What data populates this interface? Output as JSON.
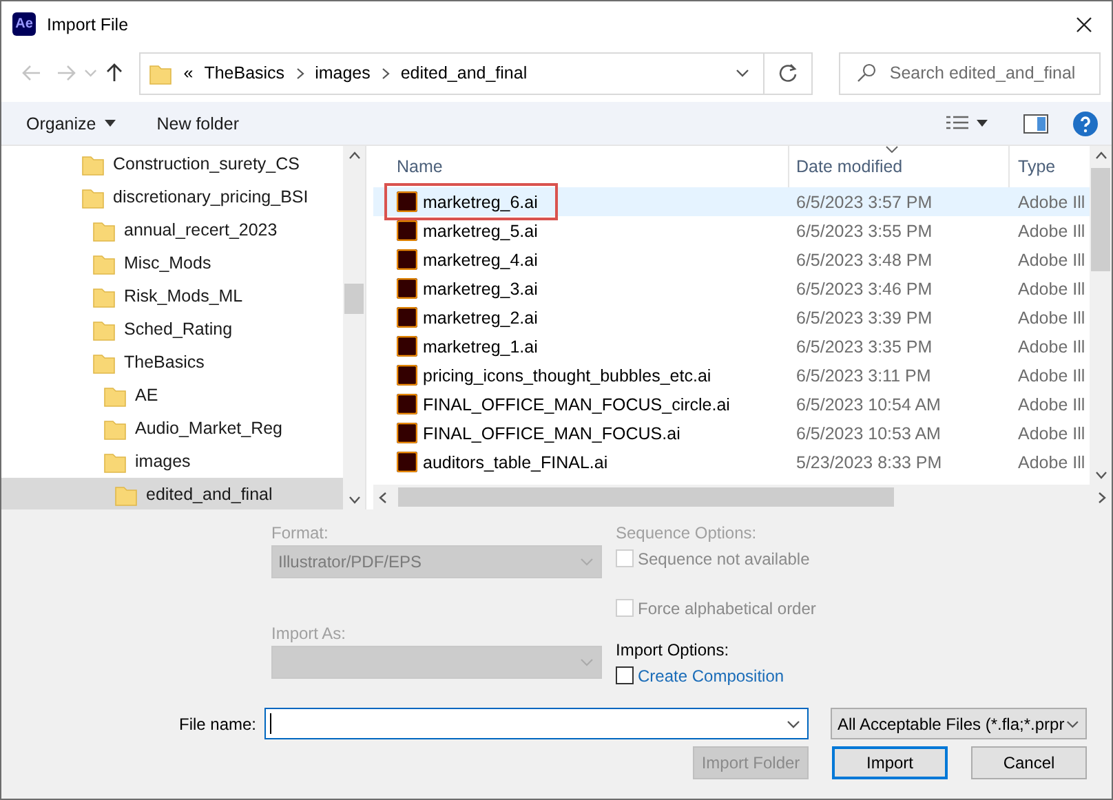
{
  "window": {
    "title": "Import File",
    "app_badge": "Ae"
  },
  "address": {
    "overflow": "«",
    "crumbs": [
      "TheBasics",
      "images",
      "edited_and_final"
    ]
  },
  "search": {
    "placeholder": "Search edited_and_final"
  },
  "toolbar": {
    "organize": "Organize",
    "new_folder": "New folder"
  },
  "tree": [
    {
      "label": "Construction_surety_CS",
      "selected": false
    },
    {
      "label": "discretionary_pricing_BSI",
      "selected": false,
      "children": [
        {
          "label": "annual_recert_2023",
          "selected": false
        },
        {
          "label": "Misc_Mods",
          "selected": false
        },
        {
          "label": "Risk_Mods_ML",
          "selected": false
        },
        {
          "label": "Sched_Rating",
          "selected": false
        },
        {
          "label": "TheBasics",
          "selected": false,
          "children": [
            {
              "label": "AE",
              "selected": false
            },
            {
              "label": "Audio_Market_Reg",
              "selected": false
            },
            {
              "label": "images",
              "selected": false,
              "children": [
                {
                  "label": "edited_and_final",
                  "selected": true
                }
              ]
            }
          ]
        }
      ]
    }
  ],
  "files": {
    "columns": [
      "Name",
      "Date modified",
      "Type"
    ],
    "rows": [
      {
        "name": "marketreg_6.ai",
        "date": "6/5/2023 3:57 PM",
        "type": "Adobe Ill",
        "selected": true,
        "outlined": true
      },
      {
        "name": "marketreg_5.ai",
        "date": "6/5/2023 3:55 PM",
        "type": "Adobe Ill",
        "selected": false,
        "outlined": false
      },
      {
        "name": "marketreg_4.ai",
        "date": "6/5/2023 3:48 PM",
        "type": "Adobe Ill",
        "selected": false,
        "outlined": false
      },
      {
        "name": "marketreg_3.ai",
        "date": "6/5/2023 3:46 PM",
        "type": "Adobe Ill",
        "selected": false,
        "outlined": false
      },
      {
        "name": "marketreg_2.ai",
        "date": "6/5/2023 3:39 PM",
        "type": "Adobe Ill",
        "selected": false,
        "outlined": false
      },
      {
        "name": "marketreg_1.ai",
        "date": "6/5/2023 3:35 PM",
        "type": "Adobe Ill",
        "selected": false,
        "outlined": false
      },
      {
        "name": "pricing_icons_thought_bubbles_etc.ai",
        "date": "6/5/2023 3:11 PM",
        "type": "Adobe Ill",
        "selected": false,
        "outlined": false
      },
      {
        "name": "FINAL_OFFICE_MAN_FOCUS_circle.ai",
        "date": "6/5/2023 10:54 AM",
        "type": "Adobe Ill",
        "selected": false,
        "outlined": false
      },
      {
        "name": "FINAL_OFFICE_MAN_FOCUS.ai",
        "date": "6/5/2023 10:53 AM",
        "type": "Adobe Ill",
        "selected": false,
        "outlined": false
      },
      {
        "name": "auditors_table_FINAL.ai",
        "date": "5/23/2023 8:33 PM",
        "type": "Adobe Ill",
        "selected": false,
        "outlined": false
      }
    ]
  },
  "options": {
    "format_label": "Format:",
    "format_value": "Illustrator/PDF/EPS",
    "format_disabled": true,
    "import_as_label": "Import As:",
    "import_as_disabled": true,
    "sequence_label": "Sequence Options:",
    "checks": [
      {
        "label": "Sequence not available",
        "checked": false,
        "disabled": true
      },
      {
        "label": "Force alphabetical order",
        "checked": false,
        "disabled": true
      }
    ],
    "import_options_label": "Import Options:",
    "create_composition": {
      "label": "Create Composition",
      "checked": false,
      "disabled": false
    }
  },
  "file_name": {
    "label": "File name:"
  },
  "filter": {
    "value": "All Acceptable Files (*.fla;*.prpr"
  },
  "buttons": [
    {
      "label": "Import Folder",
      "disabled": true,
      "default": false
    },
    {
      "label": "Import",
      "disabled": false,
      "default": true
    },
    {
      "label": "Cancel",
      "disabled": false,
      "default": false
    }
  ]
}
